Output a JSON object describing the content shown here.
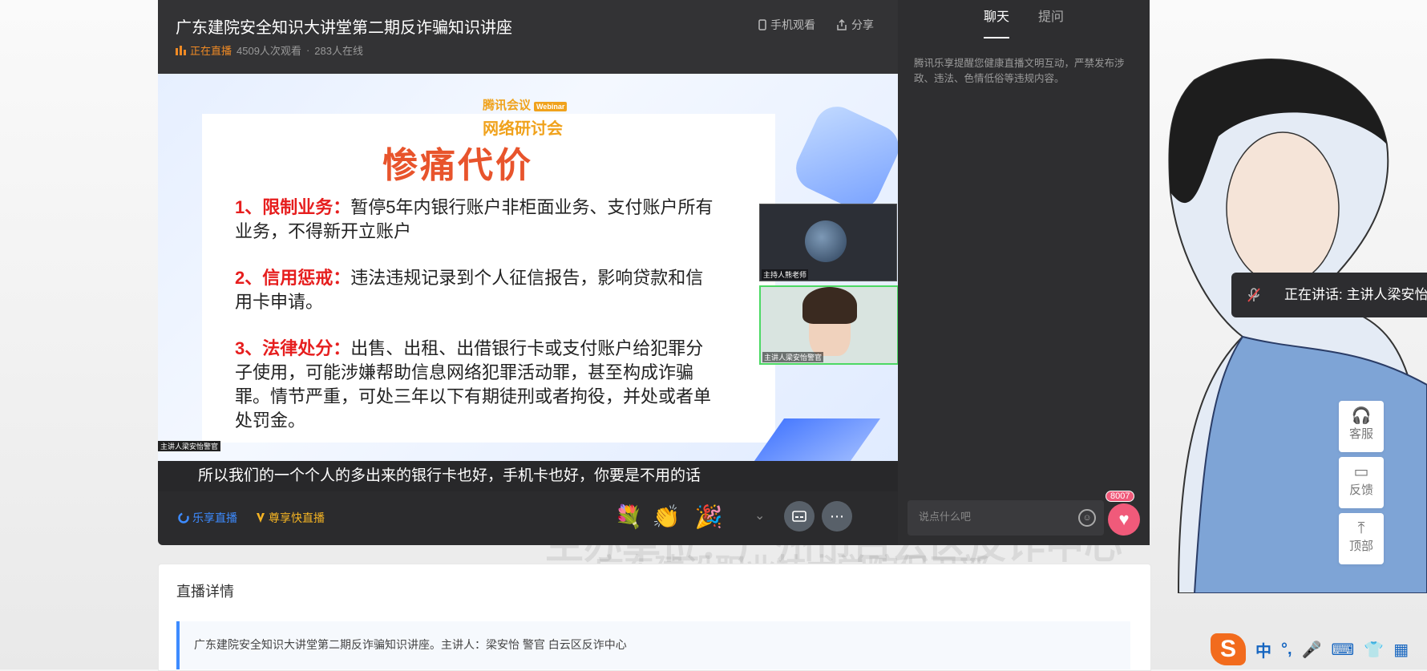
{
  "header": {
    "title": "广东建院安全知识大讲堂第二期反诈骗知识讲座",
    "live_status": "正在直播",
    "views": "4509人次观看",
    "separator": "·",
    "online": "283人在线",
    "actions": [
      "手机观看",
      "分享"
    ]
  },
  "slide": {
    "brand": "腾讯会议",
    "brand_badge": "Webinar",
    "brand_subtitle": "网络研讨会",
    "title": "惨痛代价",
    "items": [
      {
        "head": "1、限制业务：",
        "text": "暂停5年内银行账户非柜面业务、支付账户所有业务，不得新开立账户"
      },
      {
        "head": "2、信用惩戒：",
        "text": "违法违规记录到个人征信报告，影响贷款和信用卡申请。"
      },
      {
        "head": "3、法律处分：",
        "text": "出售、出租、出借银行卡或支付账户给犯罪分子使用，可能涉嫌帮助信息网络犯罪活动罪，甚至构成诈骗罪。情节严重，可处三年以下有期徒刑或者拘役，并处或者单处罚金。"
      }
    ],
    "presenter_label": "主讲人梁安怡警官"
  },
  "thumbnails": [
    {
      "label": "主持人熊老师"
    },
    {
      "label": "主讲人梁安怡警官"
    }
  ],
  "subtitle_text": "所以我们的一个个人的多出来的银行卡也好，手机卡也好，你要是不用的话",
  "bottombar": {
    "logo1": "乐享直播",
    "logo2": "尊享快直播"
  },
  "sidebar": {
    "tabs": [
      "聊天",
      "提问"
    ],
    "notice": "腾讯乐享提醒您健康直播文明互动，严禁发布涉政、违法、色情低俗等违规内容。",
    "chat_placeholder": "说点什么吧",
    "like_count": "8007"
  },
  "speaking_banner": "正在讲话: 主讲人梁安怡",
  "right_rail": [
    "客服",
    "反馈",
    "顶部"
  ],
  "details": {
    "heading": "直播详情",
    "description": "广东建院安全知识大讲堂第二期反诈骗知识讲座。主讲人：梁安怡 警官 白云区反诈中心"
  },
  "background": {
    "org_line1": "主办单位：广州市白云区反诈中心",
    "org_line2": "广东建设职业技术学院保卫部"
  },
  "ime": {
    "logo": "S",
    "items": [
      "中",
      "°,",
      "🎤",
      "⌨",
      "👕",
      "▦"
    ]
  }
}
